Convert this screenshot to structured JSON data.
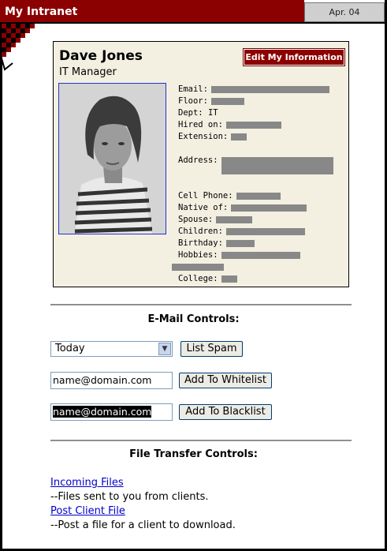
{
  "header": {
    "app_title": "My Intranet",
    "date": "Apr. 04"
  },
  "profile": {
    "name": "Dave Jones",
    "title": "IT Manager",
    "edit_button": "Edit My Information",
    "fields": [
      {
        "label": "Email:"
      },
      {
        "label": "Floor:"
      },
      {
        "label": "Dept:",
        "value": "IT"
      },
      {
        "label": "Hired on:"
      },
      {
        "label": "Extension:"
      },
      {
        "label": "Address:"
      },
      {
        "label": "Cell Phone:"
      },
      {
        "label": "Native of:"
      },
      {
        "label": "Spouse:"
      },
      {
        "label": "Children:"
      },
      {
        "label": "Birthday:"
      },
      {
        "label": "Hobbies:"
      },
      {
        "label": "College:"
      }
    ]
  },
  "email_controls": {
    "heading": "E-Mail Controls:",
    "period_select": "Today",
    "list_spam_button": "List Spam",
    "whitelist_input": "name@domain.com",
    "whitelist_button": "Add To Whitelist",
    "blacklist_input": "name@domain.com",
    "blacklist_button": "Add To Blacklist"
  },
  "file_controls": {
    "heading": "File Transfer Controls:",
    "incoming_link": "Incoming Files",
    "incoming_desc": "--Files sent to you from clients.",
    "post_link": "Post Client File",
    "post_desc": "--Post a file for a client to download."
  }
}
